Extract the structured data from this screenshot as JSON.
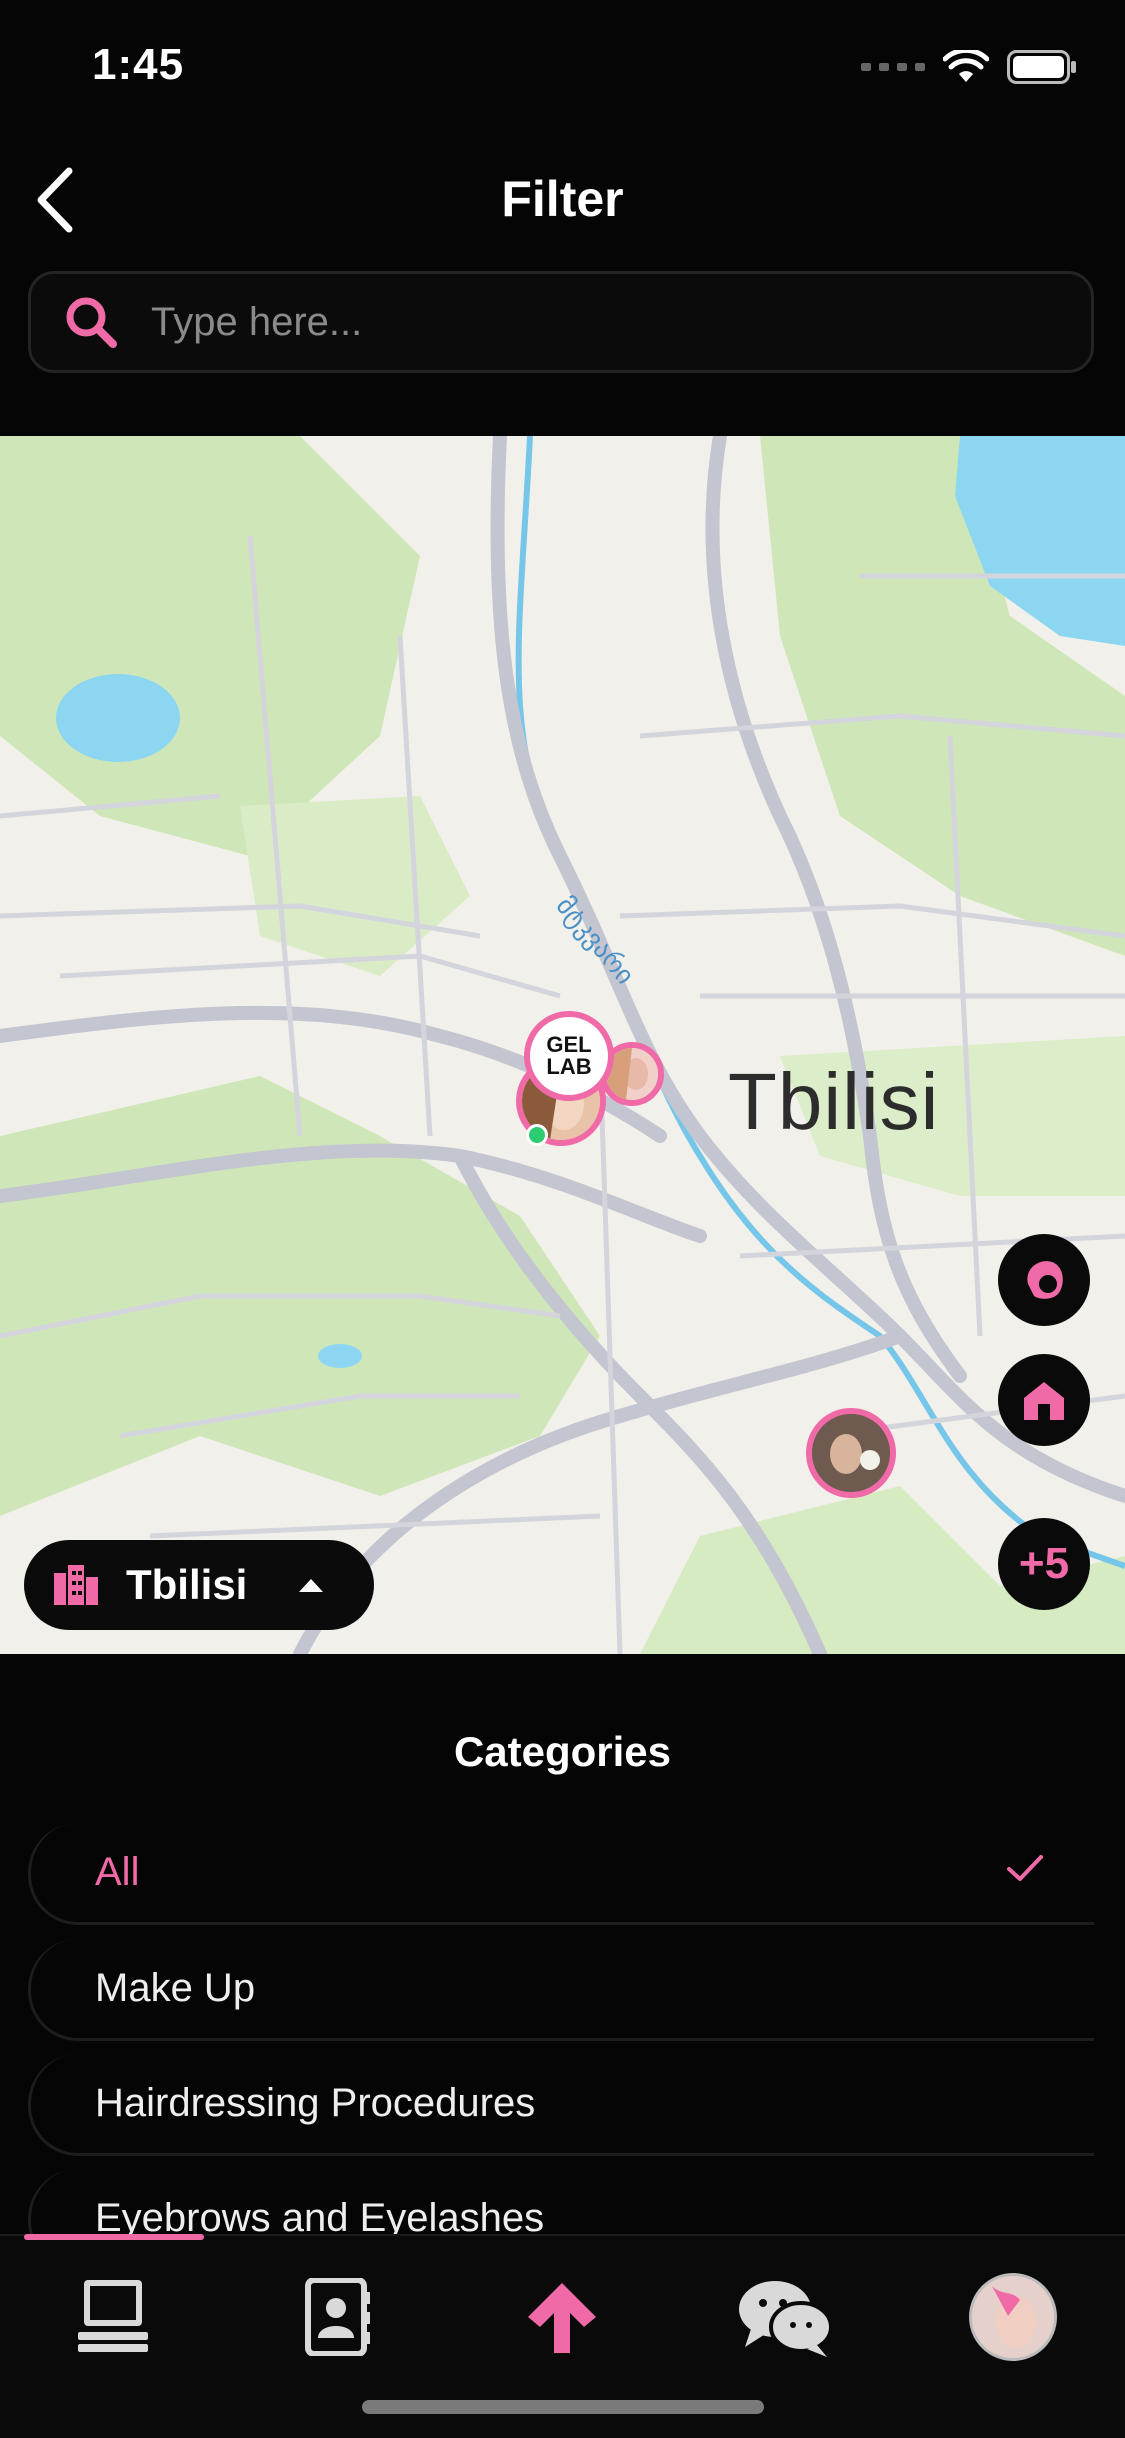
{
  "status_bar": {
    "time": "1:45"
  },
  "header": {
    "title": "Filter"
  },
  "search": {
    "placeholder": "Type here..."
  },
  "map": {
    "city_label": "Tbilisi",
    "river_label": "მტკვარი",
    "pin_logo_top": "GEL",
    "pin_logo_bottom": "LAB",
    "cluster_count": "+5",
    "city_selector": "Tbilisi"
  },
  "categories": {
    "title": "Categories",
    "items": [
      {
        "label": "All",
        "selected": true
      },
      {
        "label": "Make Up",
        "selected": false
      },
      {
        "label": "Hairdressing Procedures",
        "selected": false
      },
      {
        "label": "Eyebrows and Eyelashes",
        "selected": false
      }
    ]
  },
  "tabs": [
    {
      "icon": "laptop-icon"
    },
    {
      "icon": "contacts-icon"
    },
    {
      "icon": "arrow-up-icon"
    },
    {
      "icon": "chat-icon"
    },
    {
      "icon": "avatar"
    }
  ],
  "colors": {
    "accent": "#f06aa8",
    "background": "#050505",
    "map_green": "#cfe7b8",
    "water": "#8dd6f2"
  }
}
